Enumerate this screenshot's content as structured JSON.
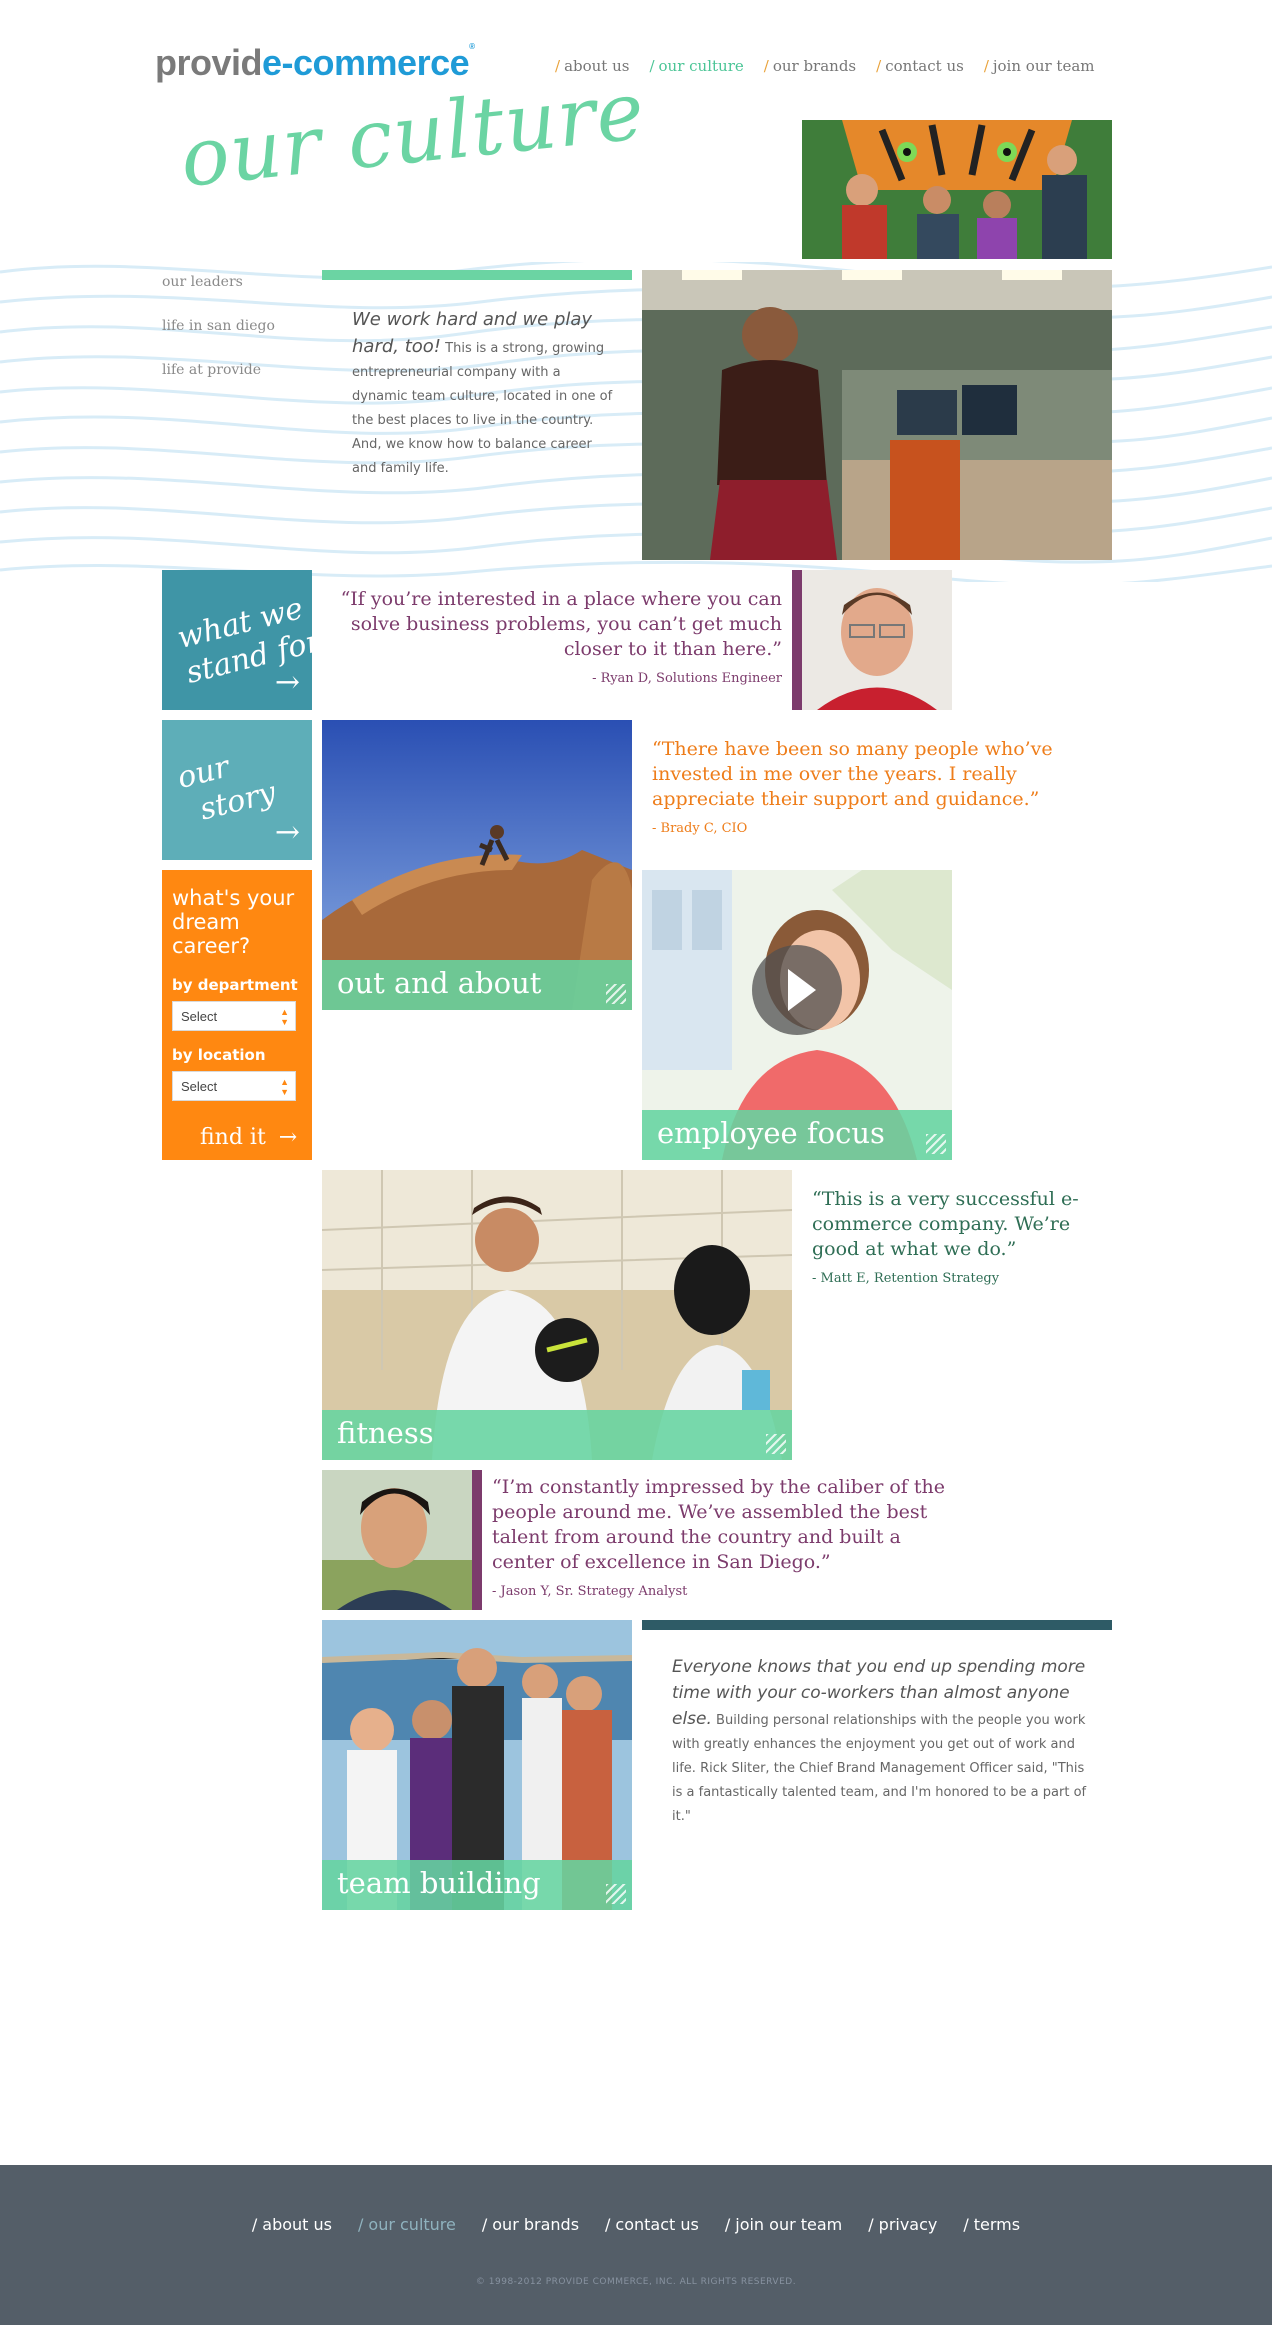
{
  "header": {
    "logo_part1": "provid",
    "logo_part2": "e-commerce",
    "logo_mark": "®",
    "nav": [
      {
        "label": "about us"
      },
      {
        "label": "our culture"
      },
      {
        "label": "our brands"
      },
      {
        "label": "contact us"
      },
      {
        "label": "join our team"
      }
    ],
    "nav_separator": "/",
    "active_nav": "our culture"
  },
  "page_title": "our culture",
  "subnav": {
    "items": [
      "our leaders",
      "life in san diego",
      "life at provide"
    ]
  },
  "intro": {
    "lead": "We work hard and we play hard, too!",
    "body": "This is a strong, growing entrepreneurial company with a dynamic team culture, located in one of the best places to live in the country. And, we know how to balance career and family life."
  },
  "tiles": {
    "stand_for": {
      "line1": "what we",
      "line2": "stand for",
      "arrow": "→"
    },
    "our_story": {
      "line1": "our",
      "line2": "story",
      "arrow": "→"
    }
  },
  "career": {
    "title": "what's your dream career?",
    "department_label": "by department",
    "department_value": "Select",
    "location_label": "by location",
    "location_value": "Select",
    "find_label": "find it",
    "arrow": "→"
  },
  "quotes": [
    {
      "text": "“If you’re interested in a place where you can solve business problems, you can’t get much closer to it than here.”",
      "attribution": "- Ryan D, Solutions Engineer"
    },
    {
      "text": "“There have been so many people who’ve invested in me over the years. I really appreciate their support and guidance.”",
      "attribution": "- Brady C, CIO"
    },
    {
      "text": "“This is a very successful e-commerce company. We’re good at what we do.”",
      "attribution": "- Matt E, Retention Strategy"
    },
    {
      "text": "“I’m constantly impressed by the caliber of the people around me. We’ve assembled the best talent from around the country and built a center of excellence in San Diego.”",
      "attribution": "- Jason Y, Sr. Strategy Analyst"
    }
  ],
  "photo_labels": {
    "out_and_about": "out and about",
    "employee_focus": "employee focus",
    "fitness": "fitness",
    "team_building": "team building"
  },
  "closing": {
    "lead": "Everyone knows that you end up spending more time with your co-workers than almost anyone else.",
    "body": "Building personal relationships with the people you work with greatly enhances the enjoyment you get out of work and life. Rick Sliter, the Chief Brand Management Officer said, \"This is a fantastically talented team, and I'm honored to be a part of it.\""
  },
  "footer": {
    "nav": [
      {
        "label": "about us"
      },
      {
        "label": "our culture"
      },
      {
        "label": "our brands"
      },
      {
        "label": "contact us"
      },
      {
        "label": "join our team"
      },
      {
        "label": "privacy"
      },
      {
        "label": "terms"
      }
    ],
    "copyright": "© 1998-2012 PROVIDE COMMERCE, INC. ALL RIGHTS RESERVED."
  },
  "colors": {
    "brand_blue": "#1f9bd7",
    "brand_green": "#6bd4a3",
    "accent_orange": "#ff8811",
    "quote_purple": "#7c3b6c",
    "quote_green": "#2f6e55",
    "footer_bg": "#545e68"
  }
}
